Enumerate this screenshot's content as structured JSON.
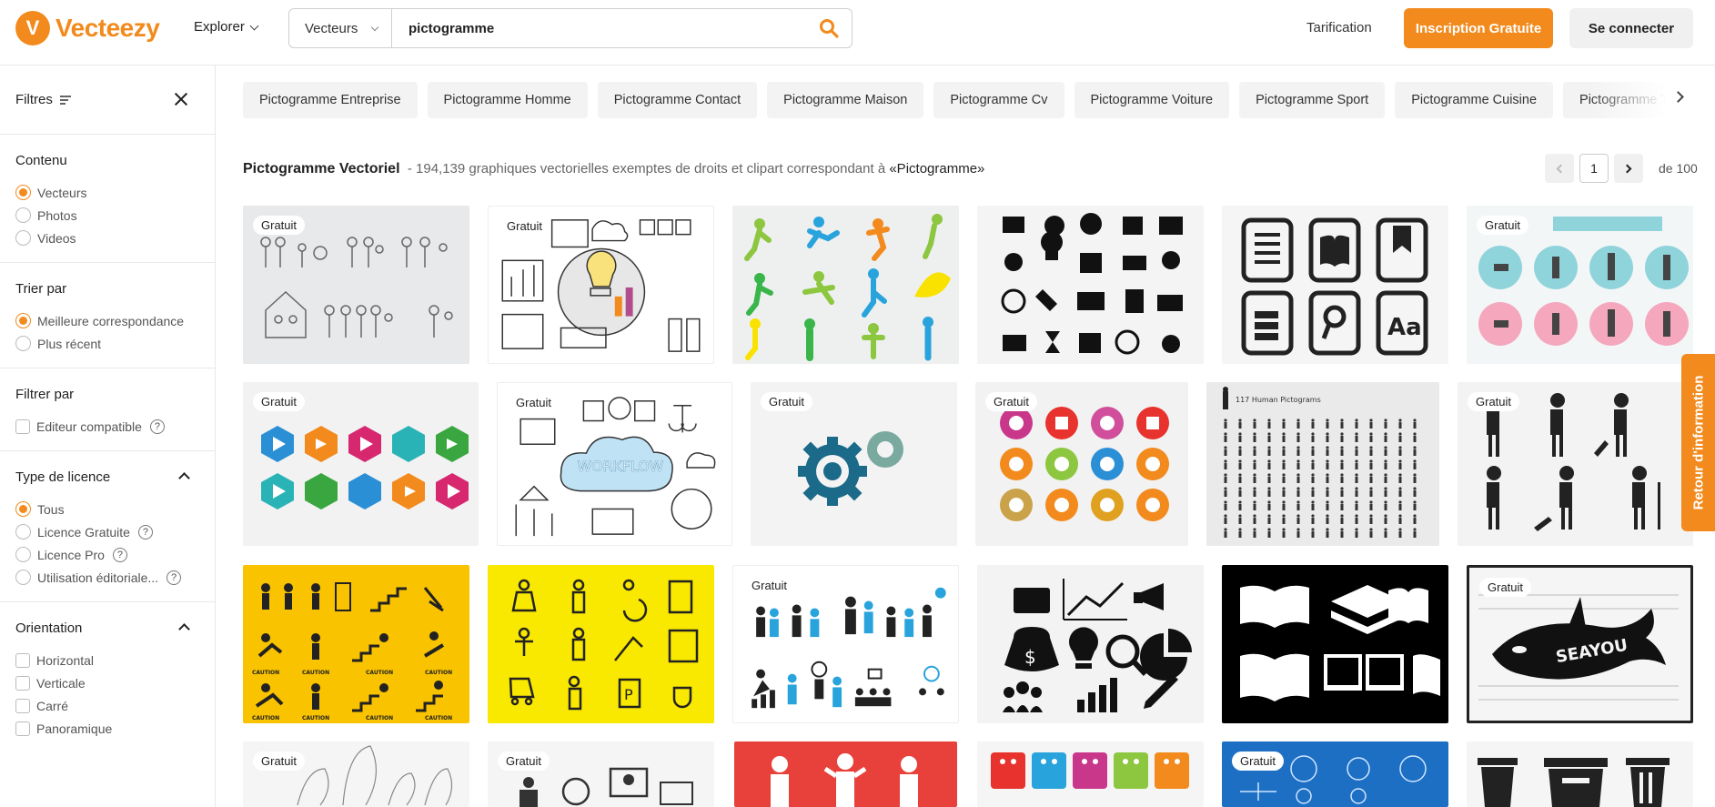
{
  "header": {
    "logo_text": "Vecteezy",
    "explore_label": "Explorer",
    "search_type": "Vecteurs",
    "search_value": "pictogramme",
    "pricing_label": "Tarification",
    "signup_label": "Inscription Gratuite",
    "login_label": "Se connecter"
  },
  "sidebar": {
    "filters_label": "Filtres",
    "content": {
      "title": "Contenu",
      "options": [
        "Vecteurs",
        "Photos",
        "Videos"
      ]
    },
    "sort": {
      "title": "Trier par",
      "options": [
        "Meilleure correspondance",
        "Plus récent"
      ]
    },
    "filter_by": {
      "title": "Filtrer par",
      "editor_label": "Editeur compatible"
    },
    "license": {
      "title": "Type de licence",
      "options": [
        "Tous",
        "Licence Gratuite",
        "Licence Pro",
        "Utilisation éditoriale..."
      ]
    },
    "orientation": {
      "title": "Orientation",
      "options": [
        "Horizontal",
        "Verticale",
        "Carré",
        "Panoramique"
      ]
    }
  },
  "tags": [
    "Pictogramme Entreprise",
    "Pictogramme Homme",
    "Pictogramme Contact",
    "Pictogramme Maison",
    "Pictogramme Cv",
    "Pictogramme Voiture",
    "Pictogramme Sport",
    "Pictogramme Cuisine",
    "Pictogramme Travail"
  ],
  "results": {
    "heading": "Pictogramme Vectoriel",
    "description": "- 194,139 graphiques vectorielles exemptes de droits et clipart correspondant à",
    "query_quoted": "«Pictogramme»",
    "page": "1",
    "of_pages": "de 100"
  },
  "badge_label": "Gratuit",
  "feedback_label": "Retour d'information",
  "colors": {
    "brand": "#f28a1d"
  }
}
